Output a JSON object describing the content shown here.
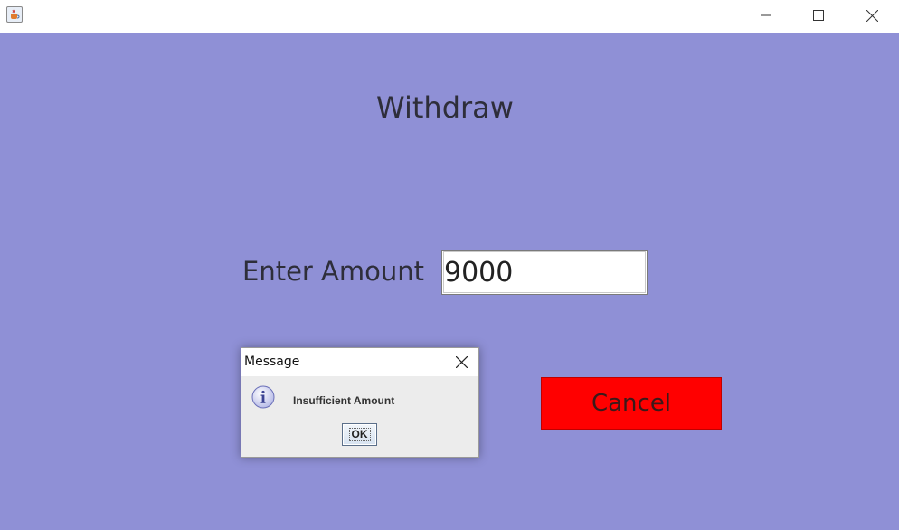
{
  "window": {
    "icon": "java-cup-icon",
    "controls": {
      "minimize": "minimize-icon",
      "maximize": "maximize-icon",
      "close": "close-icon"
    }
  },
  "colors": {
    "background": "#8f90d6",
    "cancel_button": "#ff0000",
    "text": "#2e2e3a"
  },
  "main": {
    "heading": "Withdraw",
    "amount_label": "Enter Amount",
    "amount_value": "9000",
    "cancel_label": "Cancel"
  },
  "dialog": {
    "title": "Message",
    "message": "Insufficient Amount",
    "ok_label": "OK",
    "icon": "info-icon"
  }
}
